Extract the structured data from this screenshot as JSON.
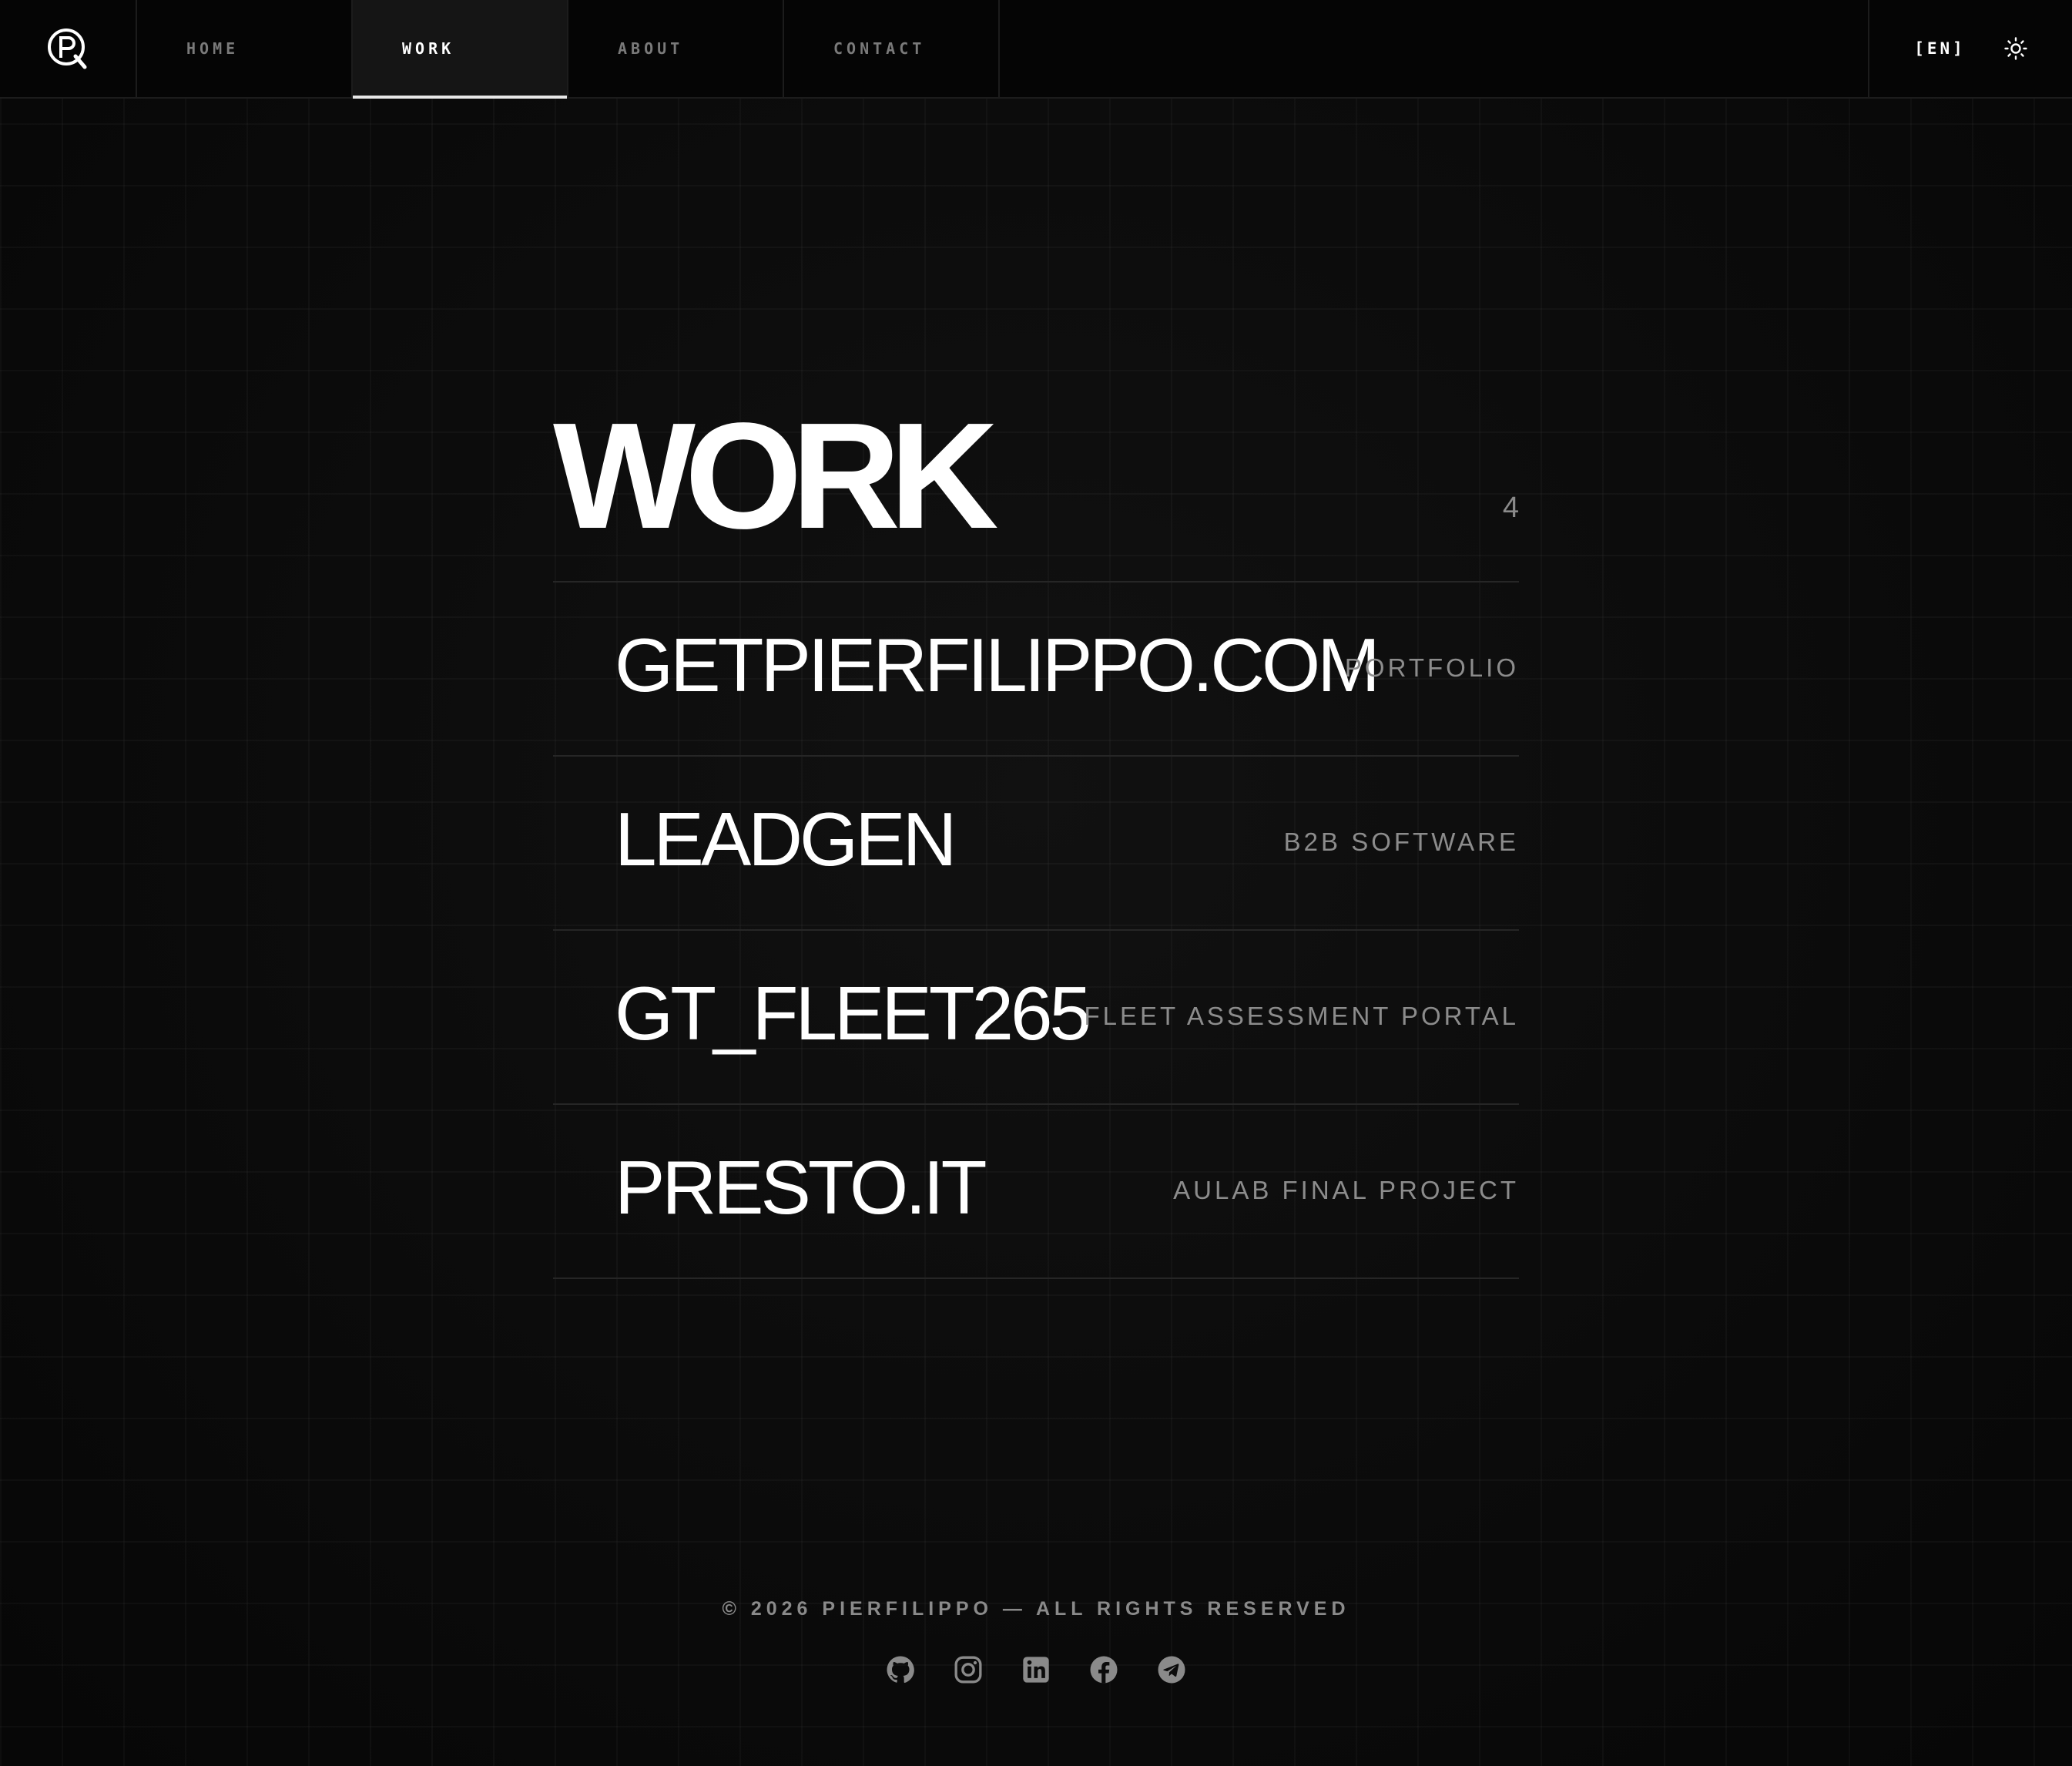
{
  "nav": {
    "logo_icon": "pq-monogram-logo",
    "items": [
      {
        "label": "HOME",
        "active": false
      },
      {
        "label": "WORK",
        "active": true
      },
      {
        "label": "ABOUT",
        "active": false
      },
      {
        "label": "CONTACT",
        "active": false
      }
    ],
    "language": "[EN]",
    "theme_icon": "sun-icon"
  },
  "main": {
    "title": "WORK",
    "count": "4",
    "projects": [
      {
        "name": "GETPIERFILIPPO.COM",
        "type": "PORTFOLIO"
      },
      {
        "name": "LEADGEN",
        "type": "B2B SOFTWARE"
      },
      {
        "name": "GT_FLEET265",
        "type": "FLEET ASSESSMENT PORTAL"
      },
      {
        "name": "PRESTO.IT",
        "type": "AULAB FINAL PROJECT"
      }
    ]
  },
  "footer": {
    "copyright": "© 2026 PIERFILIPPO — ALL RIGHTS RESERVED",
    "socials": [
      "github-icon",
      "instagram-icon",
      "linkedin-icon",
      "facebook-icon",
      "telegram-icon"
    ]
  },
  "colors": {
    "background": "#0a0a0a",
    "nav_background": "#050505",
    "text_primary": "#ffffff",
    "text_muted": "#8c8c8c",
    "divider": "#262626"
  }
}
